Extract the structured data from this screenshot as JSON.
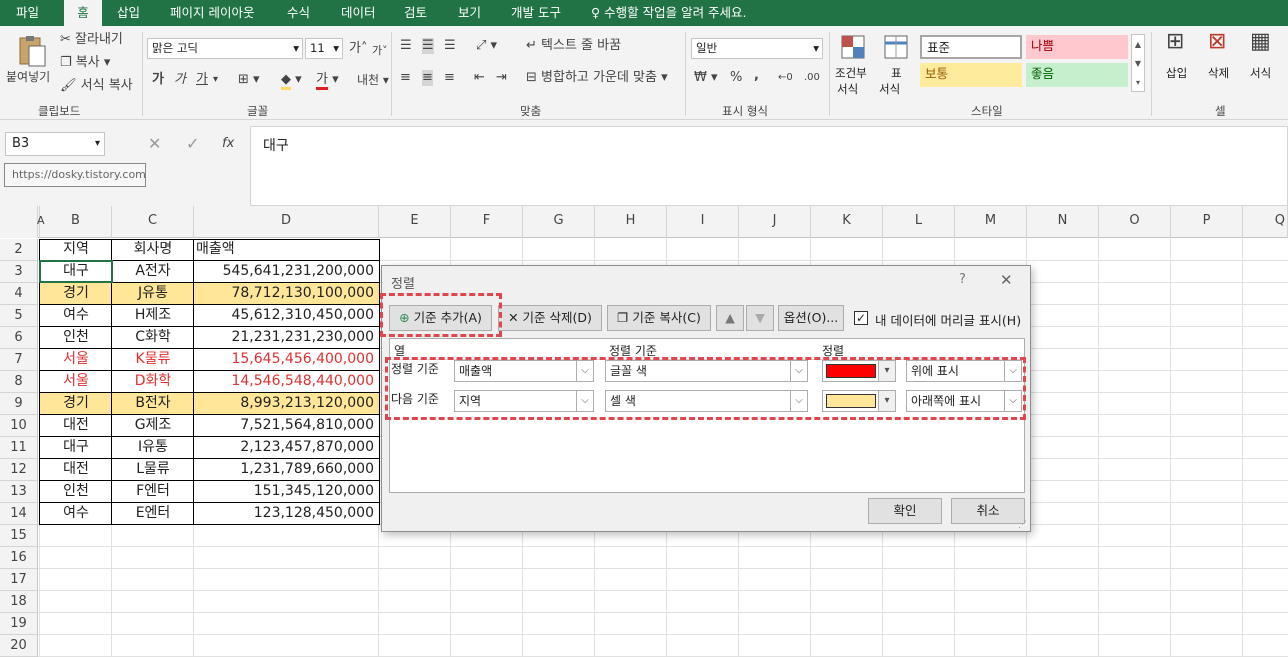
{
  "ribbon_tabs": [
    "파일",
    "홈",
    "삽입",
    "페이지 레이아웃",
    "수식",
    "데이터",
    "검토",
    "보기",
    "개발 도구"
  ],
  "tell_me": "수행할 작업을 알려 주세요.",
  "clipboard": {
    "paste": "붙여넣기",
    "cut": "잘라내기",
    "copy": "복사",
    "format_painter": "서식 복사",
    "group": "클립보드"
  },
  "font": {
    "name": "맑은 고딕",
    "size": "11",
    "group": "글꼴",
    "bold": "가",
    "italic": "가",
    "underline": "가",
    "grow": "가",
    "shrink": "가",
    "font_color": "가",
    "phonetic": "내천"
  },
  "alignment": {
    "wrap": "텍스트 줄 바꿈",
    "merge": "병합하고 가운데 맞춤",
    "group": "맞춤"
  },
  "number": {
    "format": "일반",
    "group": "표시 형식",
    "percent": "%",
    "comma": ","
  },
  "styles": {
    "cond": "조건부",
    "cond2": "서식",
    "table": "표",
    "table2": "서식",
    "normal": "표준",
    "bad": "나쁨",
    "neutral": "보통",
    "good": "좋음",
    "group": "스타일"
  },
  "cells": {
    "insert": "삽입",
    "delete": "삭제",
    "format": "서식",
    "group": "셀"
  },
  "formula_bar": {
    "name_box": "B3",
    "value": "대구",
    "tooltip": "https://dosky.tistory.com",
    "fx": "fx"
  },
  "columns": [
    "A",
    "B",
    "C",
    "D",
    "E",
    "F",
    "G",
    "H",
    "I",
    "J",
    "K",
    "L",
    "M",
    "N",
    "O",
    "P",
    "Q"
  ],
  "rows": [
    "2",
    "3",
    "4",
    "5",
    "6",
    "7",
    "8",
    "9",
    "10",
    "11",
    "12",
    "13",
    "14",
    "15",
    "16",
    "17",
    "18",
    "19",
    "20"
  ],
  "table": {
    "headers": [
      "지역",
      "회사명",
      "매출액"
    ],
    "data": [
      {
        "region": "대구",
        "company": "A전자",
        "sales": "545,641,231,200,000",
        "style": "plain"
      },
      {
        "region": "경기",
        "company": "J유통",
        "sales": "78,712,130,100,000",
        "style": "yellow"
      },
      {
        "region": "여수",
        "company": "H제조",
        "sales": "45,612,310,450,000",
        "style": "plain"
      },
      {
        "region": "인천",
        "company": "C화학",
        "sales": "21,231,231,230,000",
        "style": "plain"
      },
      {
        "region": "서울",
        "company": "K물류",
        "sales": "15,645,456,400,000",
        "style": "red"
      },
      {
        "region": "서울",
        "company": "D화학",
        "sales": "14,546,548,440,000",
        "style": "red"
      },
      {
        "region": "경기",
        "company": "B전자",
        "sales": "8,993,213,120,000",
        "style": "yellow"
      },
      {
        "region": "대전",
        "company": "G제조",
        "sales": "7,521,564,810,000",
        "style": "plain"
      },
      {
        "region": "대구",
        "company": "I유통",
        "sales": "2,123,457,870,000",
        "style": "plain"
      },
      {
        "region": "대전",
        "company": "L물류",
        "sales": "1,231,789,660,000",
        "style": "plain"
      },
      {
        "region": "인천",
        "company": "F엔터",
        "sales": "151,345,120,000",
        "style": "plain"
      },
      {
        "region": "여수",
        "company": "E엔터",
        "sales": "123,128,450,000",
        "style": "plain"
      }
    ]
  },
  "colors": {
    "excel_green": "#217346",
    "highlight_yellow": "#ffe699",
    "red_text": "#e03030",
    "sort_red": "#ff0000",
    "sort_yellow": "#ffe699",
    "dash_red": "#e0464e"
  },
  "dialog": {
    "title": "정렬",
    "help": "?",
    "close": "✕",
    "add_level": "기준 추가(A)",
    "delete_level": "기준 삭제(D)",
    "copy_level": "기준 복사(C)",
    "options": "옵션(O)...",
    "header_checkbox": "내 데이터에 머리글 표시(H)",
    "header_checked": true,
    "col_header": "열",
    "sorton_header": "정렬 기준",
    "order_header": "정렬",
    "levels": [
      {
        "label": "정렬 기준",
        "column": "매출액",
        "sort_on": "글꼴 색",
        "color": "#ff0000",
        "order": "위에 표시"
      },
      {
        "label": "다음 기준",
        "column": "지역",
        "sort_on": "셀 색",
        "color": "#ffe699",
        "order": "아래쪽에 표시"
      }
    ],
    "ok": "확인",
    "cancel": "취소"
  }
}
